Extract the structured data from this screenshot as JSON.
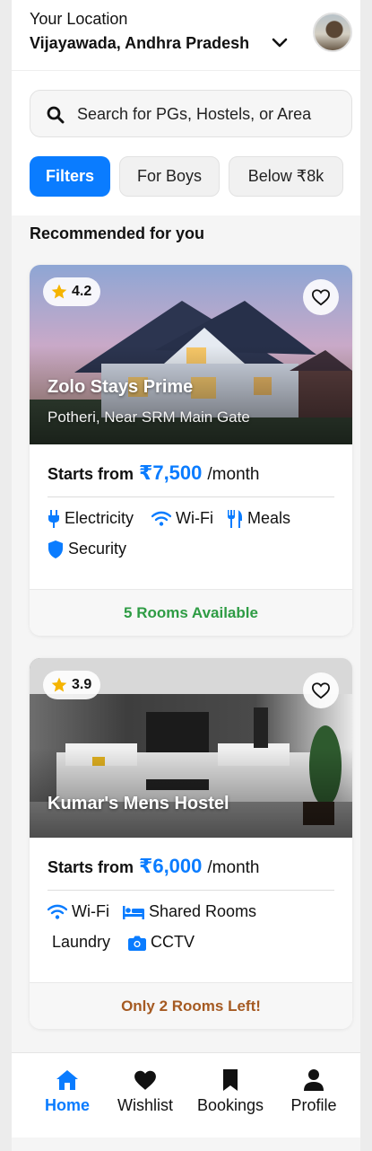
{
  "header": {
    "caption": "Your Location",
    "city": "Vijayawada, Andhra Pradesh",
    "avatar_icon": "user-avatar"
  },
  "search": {
    "text": "Search for PGs, Hostels, or Area",
    "icon": "search-icon"
  },
  "chips": [
    {
      "label": "Filters",
      "active": true
    },
    {
      "label": "For Boys",
      "active": false
    },
    {
      "label": "Below ₹8k",
      "active": false
    }
  ],
  "section_title": "Recommended for you",
  "listings": [
    {
      "rating": "4.2",
      "name": "Zolo Stays Prime",
      "location": "Potheri, Near SRM Main Gate",
      "price_label": "Starts from",
      "price": "₹7,500",
      "price_unit": "/month",
      "amenities": [
        "Electricity",
        "Wi-Fi",
        "Meals",
        "Security"
      ],
      "availability": "5 Rooms Available",
      "availability_color": "#2e9c44"
    },
    {
      "rating": "3.9",
      "name": "Kumar's Mens Hostel",
      "price_label": "Starts from",
      "price": "₹6,000",
      "price_unit": "/month",
      "amenities": [
        "Wi-Fi",
        "Shared Rooms",
        "Laundry",
        "CCTV"
      ],
      "availability": "Only 2 Rooms Left!",
      "availability_color": "#a55a22"
    }
  ],
  "nav": [
    {
      "label": "Home",
      "icon": "home-icon",
      "active": true
    },
    {
      "label": "Wishlist",
      "icon": "heart-icon",
      "active": false
    },
    {
      "label": "Bookings",
      "icon": "bookmark-icon",
      "active": false
    },
    {
      "label": "Profile",
      "icon": "user-icon",
      "active": false
    }
  ],
  "colors": {
    "accent": "#0a7cff",
    "available": "#2e9c44",
    "limited": "#a55a22",
    "star": "#f5b400"
  }
}
